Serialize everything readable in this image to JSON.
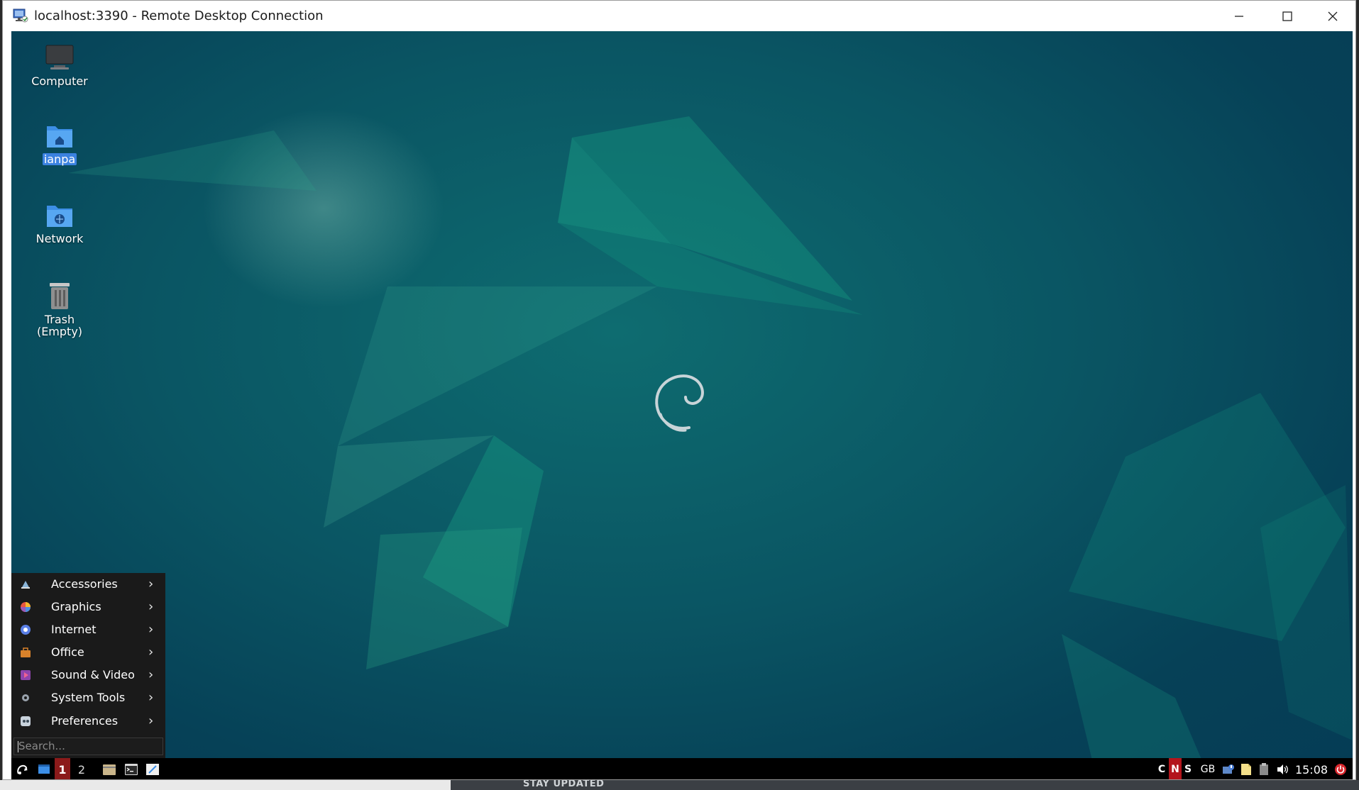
{
  "window": {
    "title": "localhost:3390 - Remote Desktop Connection",
    "controls": [
      "minimize",
      "maximize",
      "close"
    ]
  },
  "desktop": {
    "icons": [
      {
        "label": "Computer",
        "icon": "computer-icon"
      },
      {
        "label": "ianpa",
        "icon": "home-folder-icon",
        "selected": true
      },
      {
        "label": "Network",
        "icon": "network-folder-icon"
      },
      {
        "label": "Trash",
        "sublabel": "(Empty)",
        "icon": "trash-icon"
      }
    ]
  },
  "start_menu": {
    "items": [
      {
        "label": "Accessories",
        "icon": "accessories-icon"
      },
      {
        "label": "Graphics",
        "icon": "graphics-icon"
      },
      {
        "label": "Internet",
        "icon": "internet-icon"
      },
      {
        "label": "Office",
        "icon": "office-icon"
      },
      {
        "label": "Sound & Video",
        "icon": "sound-video-icon"
      },
      {
        "label": "System Tools",
        "icon": "system-tools-icon"
      },
      {
        "label": "Preferences",
        "icon": "preferences-icon"
      }
    ],
    "arrow": "›",
    "search_placeholder": "Search..."
  },
  "panel": {
    "workspaces": [
      "1",
      "2"
    ],
    "active_workspace": "1",
    "tray": {
      "caps": "C",
      "num": "N",
      "scroll": "S",
      "keyboard_layout": "GB",
      "time": "15:08"
    }
  },
  "host": {
    "peek_text": "STAY UPDATED"
  },
  "colors": {
    "selection": "#3b82e0",
    "active_workspace": "#8b1a1a",
    "num_lock": "#b3151c",
    "wallpaper_dark": "#053c55",
    "wallpaper_accent": "#12a085"
  }
}
